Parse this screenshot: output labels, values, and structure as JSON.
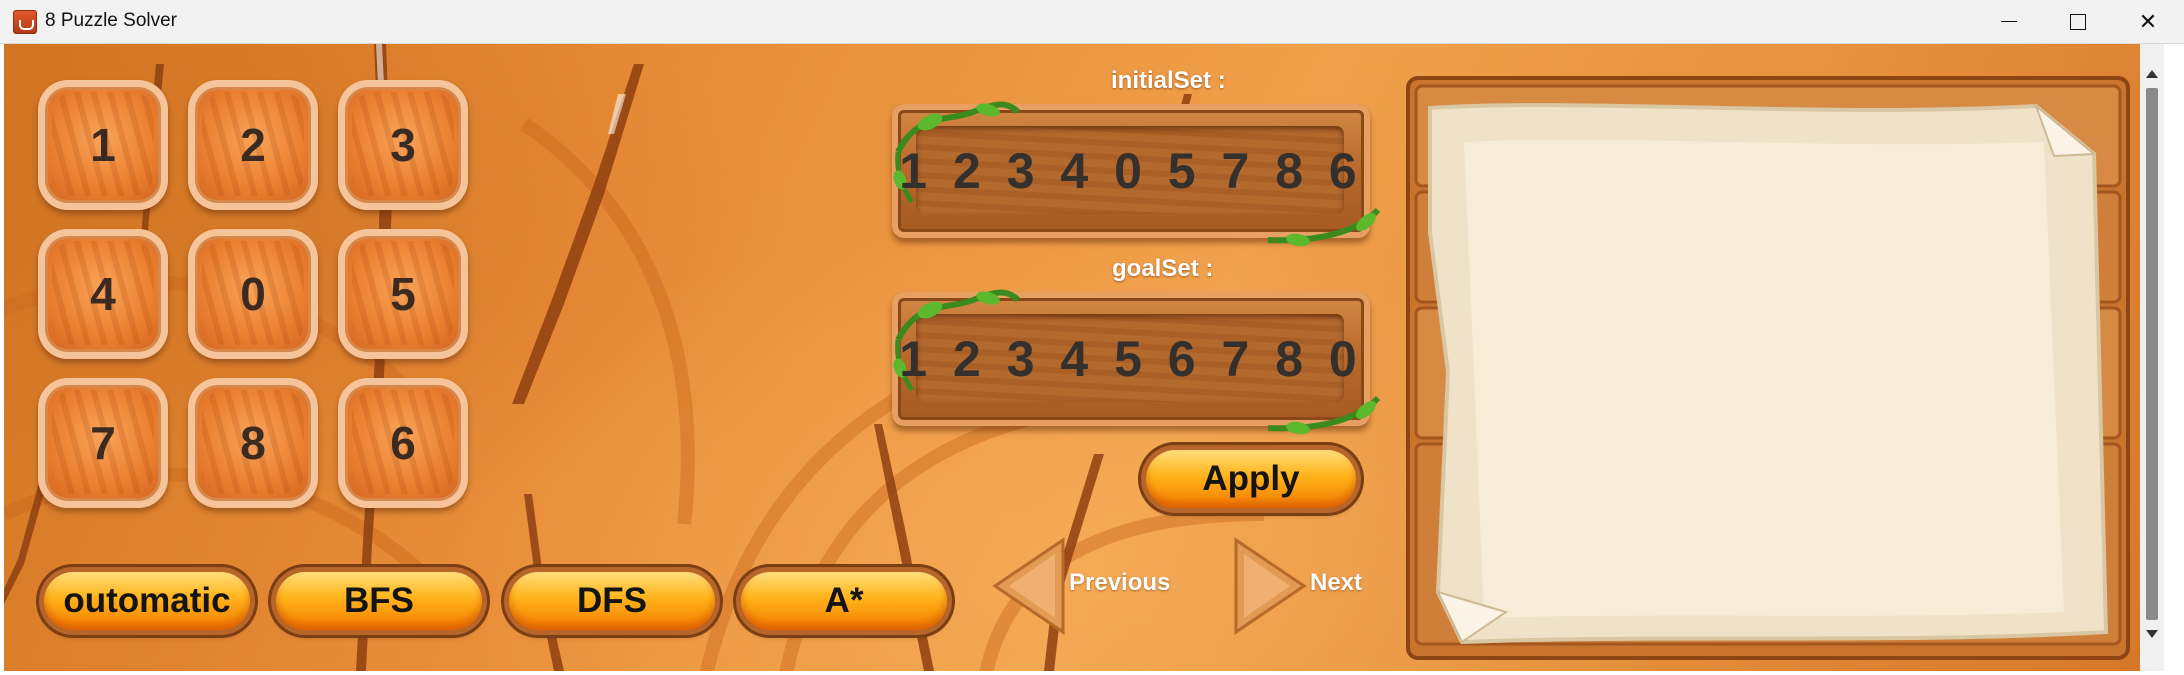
{
  "window": {
    "title": "8 Puzzle Solver",
    "minimize_icon": "minimize-icon",
    "maximize_icon": "maximize-icon",
    "close_icon": "close-icon",
    "close_symbol": "✕"
  },
  "board": {
    "tiles": [
      "1",
      "2",
      "3",
      "4",
      "0",
      "5",
      "7",
      "8",
      "6"
    ]
  },
  "initial": {
    "label": "initialSet :",
    "value": "1 2 3 4 0 5 7 8 6"
  },
  "goal": {
    "label": "goalSet :",
    "value": "1 2 3 4 5 6 7 8 0"
  },
  "apply_label": "Apply",
  "algorithms": [
    "outomatic",
    "BFS",
    "DFS",
    "A*"
  ],
  "nav": {
    "previous_label": "Previous",
    "next_label": "Next"
  },
  "colors": {
    "button_top": "#ffe07a",
    "button_bottom": "#f47d00",
    "background": "#e88d38",
    "wood": "#b8682a",
    "paper": "#f1e6cf"
  }
}
